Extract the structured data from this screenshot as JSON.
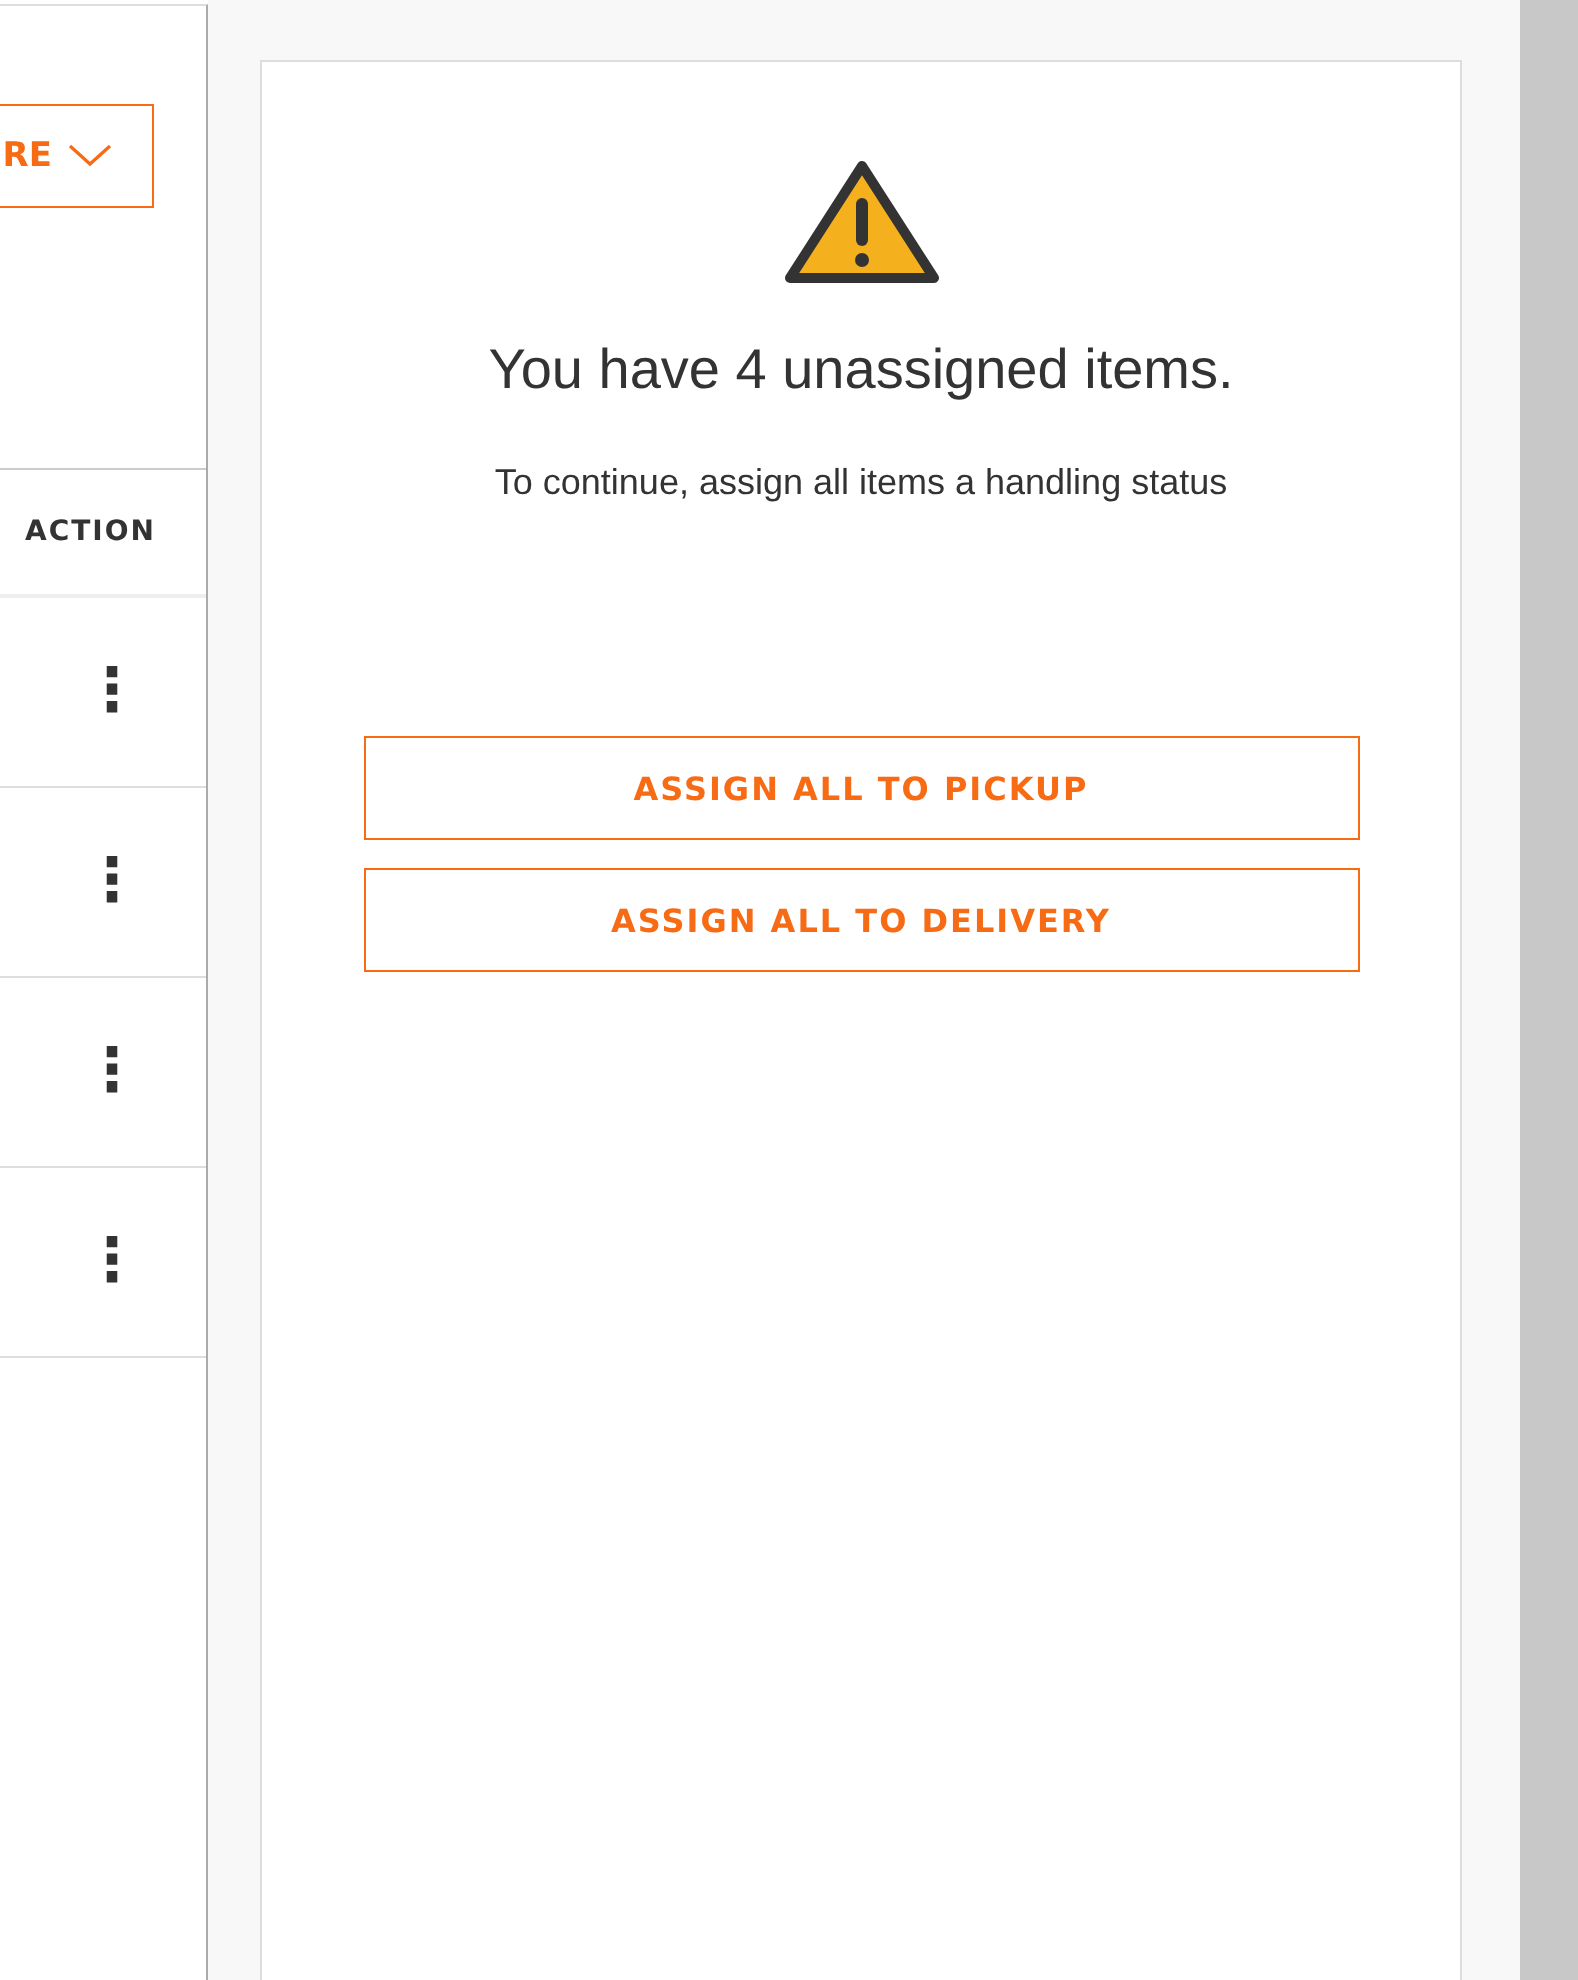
{
  "left_panel": {
    "dropdown_button": {
      "label": "RE"
    },
    "table": {
      "columns": [
        "ACTION"
      ],
      "rows": [
        {
          "action": "⋮"
        },
        {
          "action": "⋮"
        },
        {
          "action": "⋮"
        },
        {
          "action": "⋮"
        }
      ]
    }
  },
  "dialog": {
    "title": "You have 4 unassigned items.",
    "message": "To continue, assign all items a handling status",
    "buttons": [
      "ASSIGN ALL TO PICKUP",
      "ASSIGN ALL TO DELIVERY"
    ]
  }
}
